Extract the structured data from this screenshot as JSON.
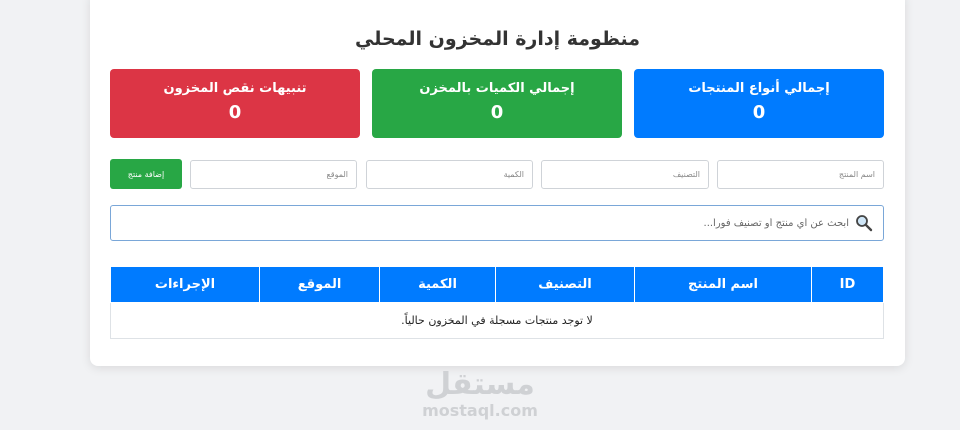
{
  "app": {
    "title": "منظومة إدارة المخزون المحلي"
  },
  "stats": [
    {
      "label": "إجمالي أنواع المنتجات",
      "value": "0",
      "color": "#007bff"
    },
    {
      "label": "إجمالي الكميات بالمخزن",
      "value": "0",
      "color": "#28a745"
    },
    {
      "label": "تنبيهات نقص المخزون",
      "value": "0",
      "color": "#dc3545"
    }
  ],
  "form": {
    "name_placeholder": "اسم المنتج",
    "category_placeholder": "التصنيف",
    "quantity_placeholder": "الكمية",
    "location_placeholder": "الموقع",
    "add_button": "إضافة منتج"
  },
  "search": {
    "placeholder": "ابحث عن أي منتج أو تصنيف فوراً...",
    "icon": "search-icon"
  },
  "table": {
    "headers": [
      "ID",
      "اسم المنتج",
      "التصنيف",
      "الكمية",
      "الموقع",
      "الإجراءات"
    ],
    "empty_message": "لا توجد منتجات مسجلة في المخزون حالياً."
  },
  "watermark": {
    "arabic": "مستقل",
    "latin": "mostaql.com"
  }
}
